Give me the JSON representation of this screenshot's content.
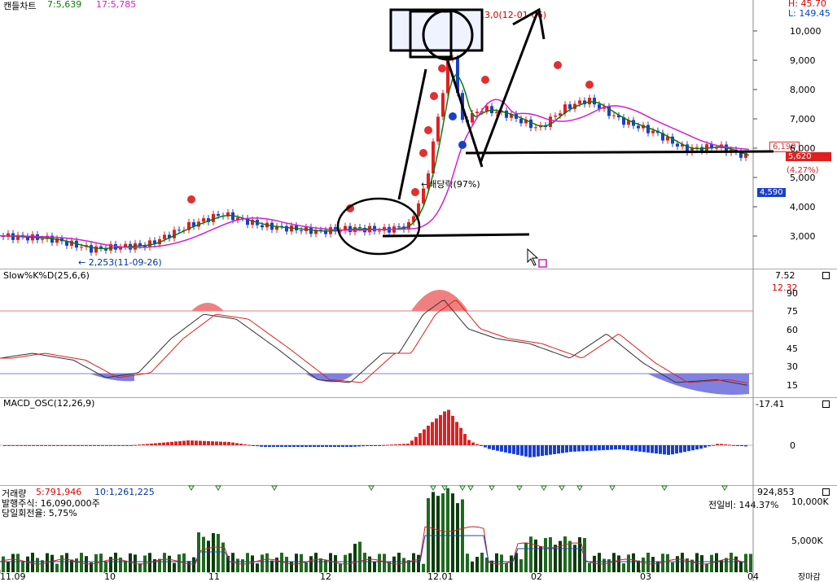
{
  "header": {
    "title": "캔들차트",
    "ma5": "7:5,639",
    "ma20": "17:5,785",
    "high": "H: 45.70",
    "low": "L: 149.45"
  },
  "annotations": {
    "low_point": "← 2,253(11-09-26)",
    "high_point": "13,0(12-01-06)",
    "dividend": "←배당락(97%)"
  },
  "price_tags": {
    "p1": "6,190",
    "current": "5,620",
    "change": "(4,27%)",
    "p2": "4,590"
  },
  "price_axis": [
    "10,000",
    "9,000",
    "8,000",
    "7,000",
    "6,000",
    "5,000",
    "4,000",
    "3,000"
  ],
  "stoch": {
    "title": "Slow%K%D(25,6,6)",
    "k": "7.52",
    "d": "12.32",
    "axis": [
      "90",
      "75",
      "60",
      "45",
      "30",
      "15"
    ]
  },
  "macd": {
    "title": "MACD_OSC(12,26,9)",
    "value": "-17.41",
    "axis": [
      "0"
    ]
  },
  "volume": {
    "title": "거래량",
    "ma5": "5:791,946",
    "ma10": "10:1,261,225",
    "shares": "발행주식: 16,090,000주",
    "turnover": "당일회전율: 5,75%",
    "current": "924,853",
    "ratio": "전일비: 144.37%",
    "axis": [
      "10,000K",
      "5,000K"
    ]
  },
  "x_axis": [
    "11.09",
    "10",
    "11",
    "12",
    "12.01",
    "02",
    "03",
    "04"
  ],
  "corner": "장마감",
  "chart_data": {
    "type": "line",
    "x": [
      "11.09",
      "10",
      "11",
      "12",
      "12.01",
      "02",
      "03",
      "04"
    ],
    "series": [
      {
        "name": "7:5,639",
        "values": [
          2900,
          2600,
          3600,
          3000,
          8500,
          7000,
          6600,
          5620
        ]
      },
      {
        "name": "17:5,785",
        "values": [
          2950,
          2650,
          3500,
          3100,
          6800,
          7200,
          6800,
          5785
        ]
      }
    ],
    "ylim": [
      2000,
      11000
    ]
  }
}
